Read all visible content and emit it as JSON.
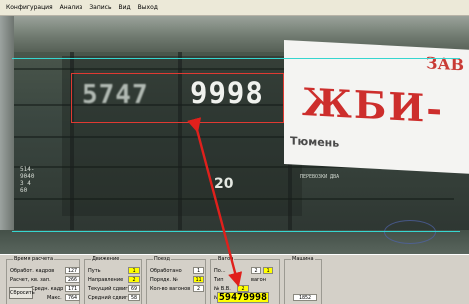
{
  "menu": [
    "Конфигурация",
    "Анализ",
    "Запись",
    "Вид",
    "Выход"
  ],
  "video": {
    "plate_blurred": "5747",
    "plate_sharp": "9998",
    "stencil_left": [
      "514-",
      "9040",
      "3 4",
      "60"
    ],
    "stencil_bottom": "ПЕРЕВОЗКИ ДВА",
    "car_side_number": "20",
    "banner_top": "ЗАВ",
    "banner_main": "ЖБИ-",
    "banner_sub": "Тюмень"
  },
  "colors": {
    "roi": "#e03a32",
    "guide": "#36d6cf",
    "highlight": "#ffff00"
  },
  "groups": {
    "speed": {
      "title": "Время расчета",
      "rows": [
        {
          "label": "Обработ. кадров",
          "value": "127"
        },
        {
          "label": "Расчет, кв. зап.",
          "value": "266"
        },
        {
          "label": "Средн. кадр",
          "value": "171"
        },
        {
          "label": "Макс.",
          "value": "764"
        }
      ],
      "reset_button": "Сбросить"
    },
    "motion": {
      "title": "Движение",
      "rows": [
        {
          "label": "Путь",
          "value": "1"
        },
        {
          "label": "Направление",
          "value": "2"
        },
        {
          "label": "Текущий сдвиг",
          "value": "69"
        },
        {
          "label": "Средний сдвиг",
          "value": "58"
        }
      ]
    },
    "train": {
      "title": "Поезд",
      "rows": [
        {
          "label": "Обработано",
          "value": "1"
        },
        {
          "label": "Порядк. №",
          "value": "11"
        },
        {
          "label": "Кол-во вагонов",
          "value": "2"
        }
      ]
    },
    "wagon": {
      "title": "Вагон",
      "rows": [
        {
          "label": "По...",
          "value": "2",
          "value2": "1"
        },
        {
          "label": "Тип",
          "value": "вагон"
        },
        {
          "label": "№ В.В.",
          "value": "2"
        },
        {
          "label": "№",
          "value": "59479998"
        }
      ]
    },
    "engine": {
      "title": "Машина",
      "value": "1852"
    }
  }
}
